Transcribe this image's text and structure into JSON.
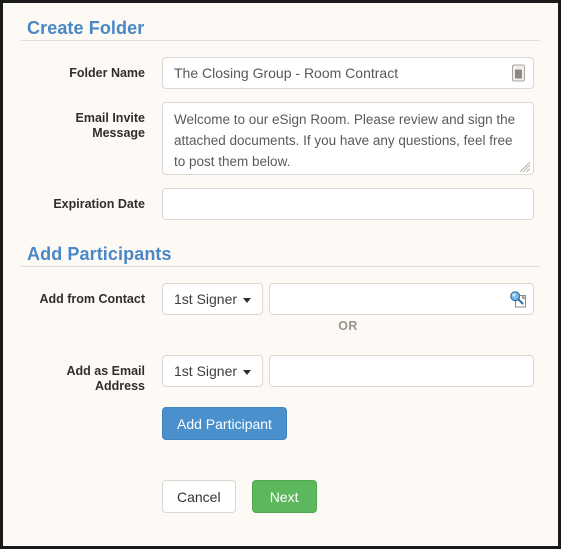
{
  "sections": {
    "create_folder": {
      "heading": "Create Folder",
      "fields": {
        "folder_name": {
          "label": "Folder Name",
          "value": "The Closing Group - Room Contract",
          "icon": "password-manager-icon"
        },
        "email_invite_message": {
          "label": "Email Invite Message",
          "value": "Welcome to our eSign Room. Please review and sign the attached documents. If you have any questions, feel free to post them below."
        },
        "expiration_date": {
          "label": "Expiration Date",
          "value": "",
          "placeholder": ""
        }
      }
    },
    "add_participants": {
      "heading": "Add Participants",
      "or_divider": "OR",
      "add_from_contact": {
        "label": "Add from Contact",
        "role_selected": "1st Signer",
        "value": "",
        "search_icon": "search-contact-icon"
      },
      "add_as_email": {
        "label": "Add as Email Address",
        "role_selected": "1st Signer",
        "value": ""
      },
      "add_participant_button": "Add Participant"
    }
  },
  "actions": {
    "cancel": "Cancel",
    "next": "Next"
  },
  "colors": {
    "heading_blue": "#4a87c7",
    "primary_button": "#4a90cd",
    "success_button": "#5cb85c",
    "page_background": "#fdf9f5",
    "field_border": "#ddd7d1",
    "label_text": "#2f2f2f",
    "or_text": "#9b948f"
  }
}
